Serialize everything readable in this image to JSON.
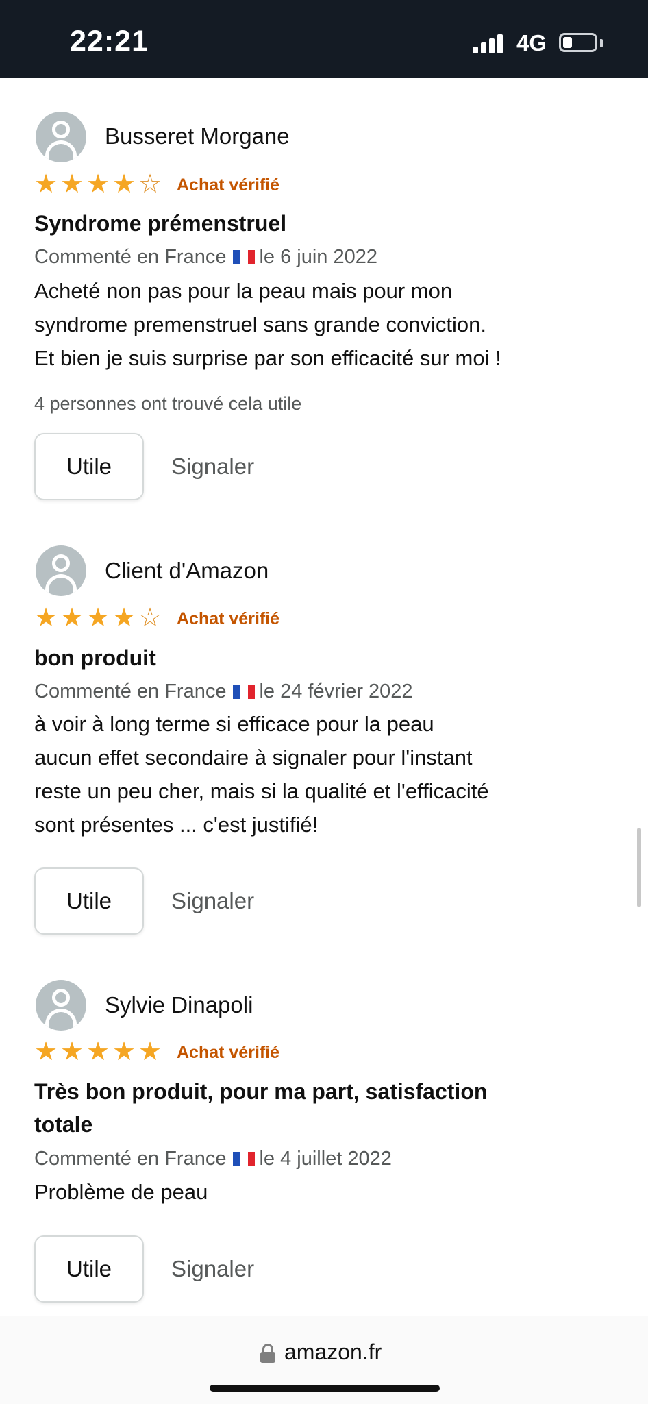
{
  "status": {
    "time": "22:21",
    "network": "4G"
  },
  "reviews": [
    {
      "author": "Busseret Morgane",
      "rating": 4,
      "verified": "Achat vérifié",
      "title": "Syndrome prémenstruel",
      "meta_prefix": "Commenté en France",
      "meta_date": "le 6 juin 2022",
      "body_lines": [
        "Acheté non pas pour la peau mais pour mon",
        "syndrome premenstruel sans grande conviction.",
        "Et bien je suis surprise par son efficacité sur moi !"
      ],
      "helpful_text": "4 personnes ont trouvé cela utile",
      "helpful_button": "Utile",
      "report_link": "Signaler"
    },
    {
      "author": "Client d'Amazon",
      "rating": 4,
      "verified": "Achat vérifié",
      "title": "bon produit",
      "meta_prefix": "Commenté en France",
      "meta_date": "le 24 février 2022",
      "body_lines": [
        "à voir à long terme si efficace pour la peau",
        "aucun effet secondaire à signaler pour l'instant",
        "reste un peu cher, mais si la qualité et l'efficacité",
        "sont présentes ... c'est justifié!"
      ],
      "helpful_button": "Utile",
      "report_link": "Signaler"
    },
    {
      "author": "Sylvie Dinapoli",
      "rating": 5,
      "verified": "Achat vérifié",
      "title_lines": [
        "Très bon produit, pour ma part, satisfaction",
        "totale"
      ],
      "meta_prefix": "Commenté en France",
      "meta_date": "le 4 juillet 2022",
      "body_lines": [
        "Problème de peau"
      ],
      "helpful_button": "Utile",
      "report_link": "Signaler"
    }
  ],
  "browser": {
    "domain": "amazon.fr"
  },
  "colors": {
    "star": "#f5a623",
    "verified": "#c45500",
    "status_bar": "#141b24"
  },
  "icons": [
    "user-avatar-icon",
    "star-icon",
    "france-flag-icon",
    "lock-icon"
  ]
}
